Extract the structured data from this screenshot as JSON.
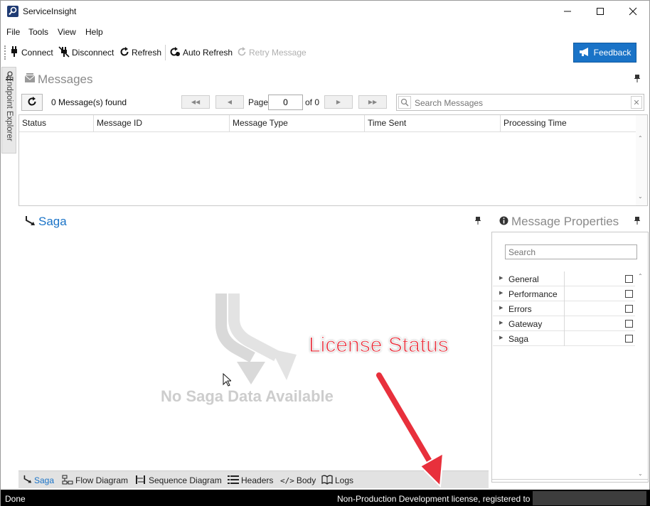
{
  "window": {
    "title": "ServiceInsight"
  },
  "menu": {
    "items": [
      "File",
      "Tools",
      "View",
      "Help"
    ]
  },
  "toolbar": {
    "connect": "Connect",
    "disconnect": "Disconnect",
    "refresh": "Refresh",
    "auto_refresh": "Auto Refresh",
    "retry_message": "Retry Message",
    "feedback": "Feedback"
  },
  "side_tab": {
    "label": "Endpoint Explorer"
  },
  "messages": {
    "title": "Messages",
    "found_text": "0 Message(s) found",
    "page_label": "Page",
    "page_value": "0",
    "of_label": "of 0",
    "search_placeholder": "Search Messages",
    "columns": [
      "Status",
      "Message ID",
      "Message Type",
      "Time Sent",
      "Processing Time"
    ]
  },
  "saga": {
    "title": "Saga",
    "empty_text": "No Saga Data Available"
  },
  "bottom_tabs": [
    "Saga",
    "Flow Diagram",
    "Sequence Diagram",
    "Headers",
    "Body",
    "Logs"
  ],
  "properties": {
    "title": "Message Properties",
    "search_placeholder": "Search",
    "categories": [
      "General",
      "Performance",
      "Errors",
      "Gateway",
      "Saga"
    ]
  },
  "status_bar": {
    "left": "Done",
    "right": "Non-Production Development license, registered to"
  },
  "annotation": {
    "text": "License Status"
  },
  "colors": {
    "accent": "#1a73c7",
    "annotation": "#e8303c",
    "status_bg": "#000000"
  }
}
